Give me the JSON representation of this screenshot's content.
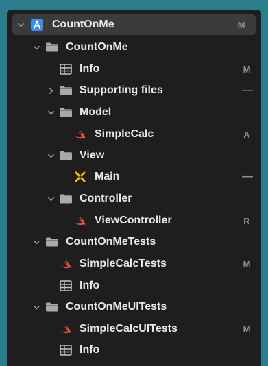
{
  "navigator": {
    "rows": [
      {
        "label": "CountOnMe",
        "status": "M",
        "icon": "project-icon"
      },
      {
        "label": "CountOnMe",
        "status": "",
        "icon": "folder-icon"
      },
      {
        "label": "Info",
        "status": "M",
        "icon": "plist-table-icon"
      },
      {
        "label": "Supporting files",
        "status": "—",
        "icon": "folder-icon"
      },
      {
        "label": "Model",
        "status": "",
        "icon": "folder-icon"
      },
      {
        "label": "SimpleCalc",
        "status": "A",
        "icon": "swift-file-icon"
      },
      {
        "label": "View",
        "status": "",
        "icon": "folder-icon"
      },
      {
        "label": "Main",
        "status": "—",
        "icon": "storyboard-icon"
      },
      {
        "label": "Controller",
        "status": "",
        "icon": "folder-icon"
      },
      {
        "label": "ViewController",
        "status": "R",
        "icon": "swift-file-icon"
      },
      {
        "label": "CountOnMeTests",
        "status": "",
        "icon": "folder-icon"
      },
      {
        "label": "SimpleCalcTests",
        "status": "M",
        "icon": "swift-file-icon"
      },
      {
        "label": "Info",
        "status": "",
        "icon": "plist-table-icon"
      },
      {
        "label": "CountOnMeUITests",
        "status": "",
        "icon": "folder-icon"
      },
      {
        "label": "SimpleCalcUITests",
        "status": "M",
        "icon": "swift-file-icon"
      },
      {
        "label": "Info",
        "status": "",
        "icon": "plist-table-icon"
      }
    ]
  },
  "colors": {
    "background": "#2a7d8c",
    "panel": "#1e1e1f",
    "selection": "#3b3b3d",
    "text": "#e8e8ea",
    "status": "#8d8d92",
    "swift": "#f05138",
    "project": "#3b8df0",
    "storyboard": "#f2c500"
  }
}
